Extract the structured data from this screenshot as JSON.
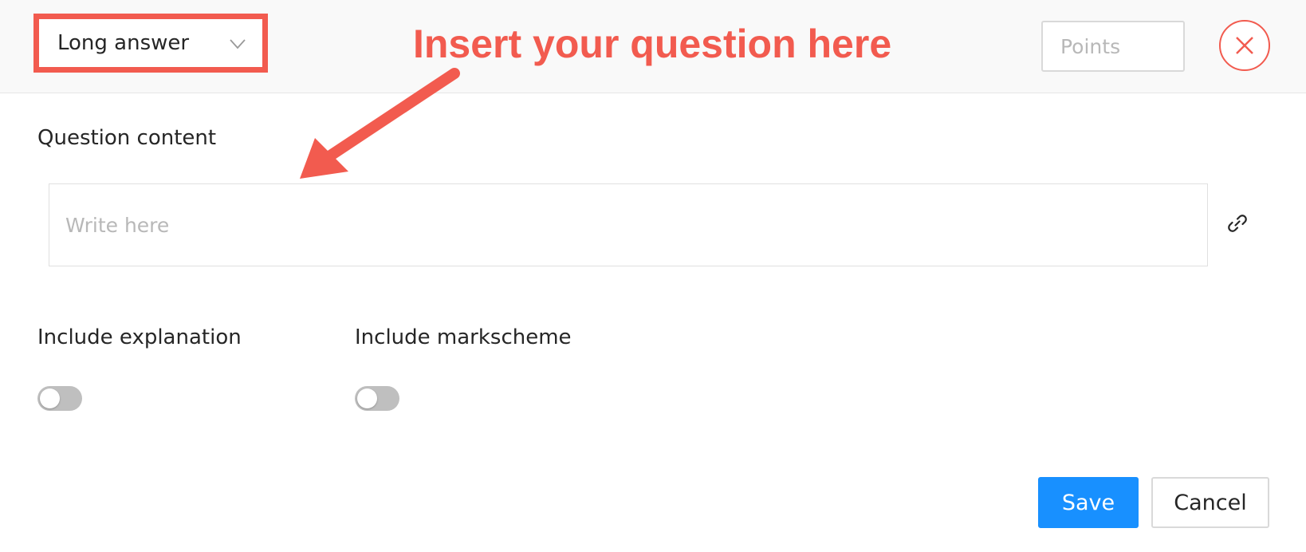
{
  "header": {
    "question_type": "Long answer",
    "points_placeholder": "Points"
  },
  "annotation": {
    "text": "Insert your question here",
    "color": "#f25b4f"
  },
  "question": {
    "label": "Question content",
    "placeholder": "Write here"
  },
  "options": {
    "explanation_label": "Include explanation",
    "explanation_enabled": false,
    "markscheme_label": "Include markscheme",
    "markscheme_enabled": false
  },
  "icons": {
    "dropdown": "chevron-down-icon",
    "close": "close-icon",
    "link": "link-icon"
  },
  "footer": {
    "save_label": "Save",
    "cancel_label": "Cancel"
  },
  "colors": {
    "accent": "#1890ff",
    "annotation": "#f25b4f",
    "toggle_off": "#bfbfbf"
  }
}
